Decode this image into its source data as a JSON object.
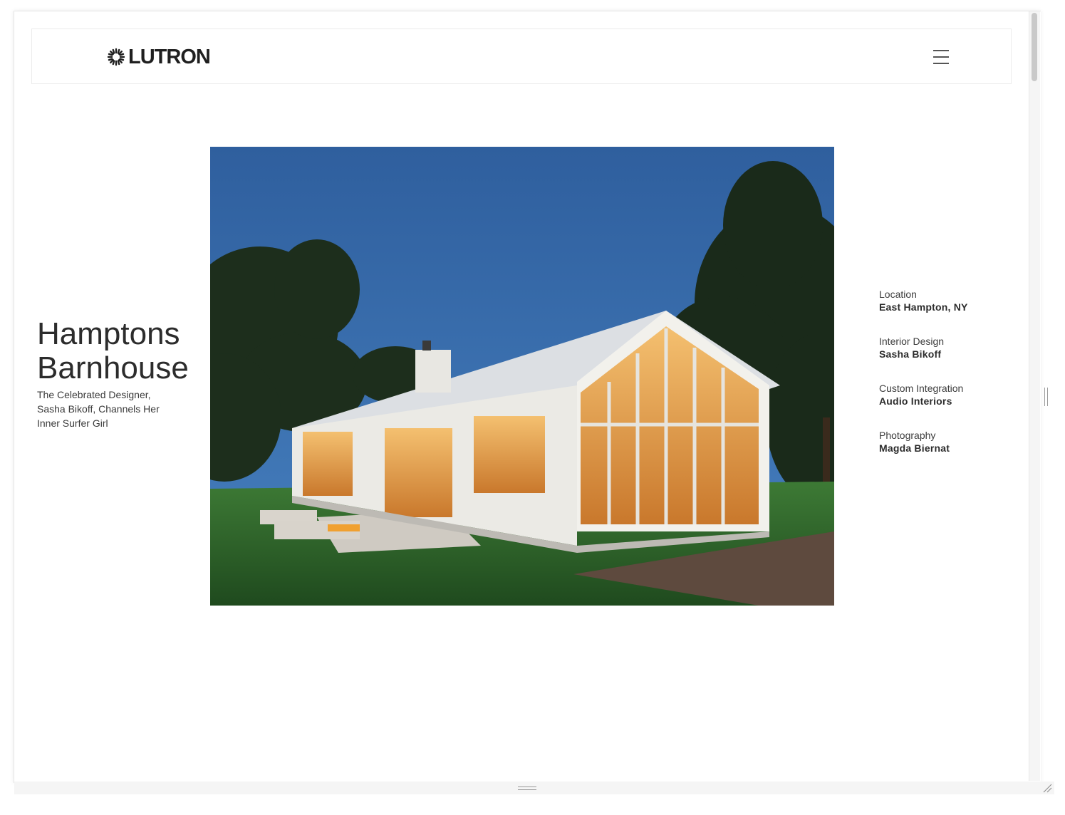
{
  "header": {
    "logo_text": "LUTRON",
    "menu_icon": "hamburger-menu-icon"
  },
  "project": {
    "title": "Hamptons Barnhouse",
    "subtitle": "The Celebrated Designer, Sasha Bikoff, Channels Her Inner Surfer Girl"
  },
  "photo": {
    "subject": "barnhouse-dusk-photo"
  },
  "details": [
    {
      "label": "Location",
      "value": "East Hampton, NY"
    },
    {
      "label": "Interior Design",
      "value": "Sasha Bikoff"
    },
    {
      "label": "Custom Integration",
      "value": "Audio Interiors"
    },
    {
      "label": "Photography",
      "value": "Magda Biernat"
    }
  ],
  "colors": {
    "sky_top": "#2f5f9e",
    "sky_bottom": "#3f76b3",
    "lawn": "#2f6a2e",
    "interior_glow": "#e8a04a"
  }
}
